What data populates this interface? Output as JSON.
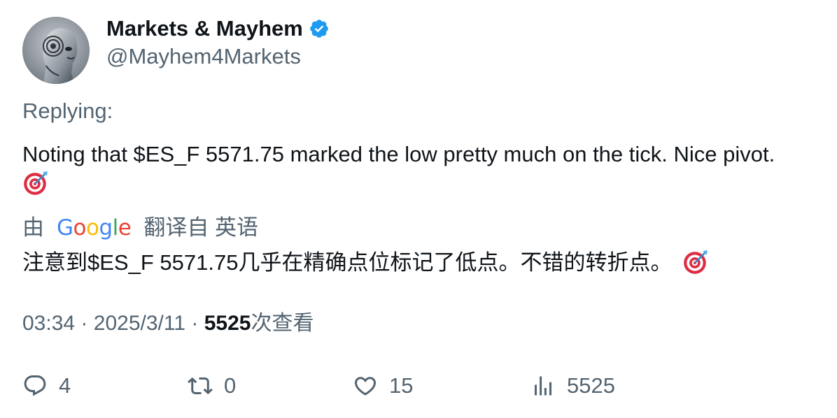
{
  "author": {
    "display_name": "Markets & Mayhem",
    "handle": "@Mayhem4Markets",
    "verified": true
  },
  "replying_label": "Replying:",
  "tweet": {
    "text": "Noting that $ES_F 5571.75 marked the low pretty much on the tick. Nice pivot.",
    "emoji": "direct-hit-emoji"
  },
  "translation": {
    "prefix": "由",
    "provider": "Google",
    "suffix": "翻译自 英语",
    "text": "注意到$ES_F 5571.75几乎在精确点位标记了低点。不错的转折点。"
  },
  "meta": {
    "time": "03:34",
    "separator": "·",
    "date": "2025/3/11",
    "views_count": "5525",
    "views_label": "次查看"
  },
  "actions": {
    "replies": "4",
    "reposts": "0",
    "likes": "15",
    "views": "5525"
  },
  "colors": {
    "text_primary": "#0f1419",
    "text_secondary": "#536471",
    "verified_blue": "#1d9bf0"
  }
}
